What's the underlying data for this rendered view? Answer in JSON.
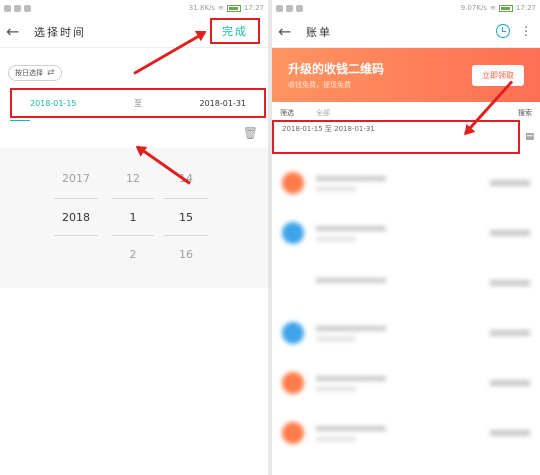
{
  "left": {
    "status_bar": {
      "text": "31.8K/s",
      "time": "17:27"
    },
    "title": "选择时间",
    "done_label": "完成",
    "chip_label": "按日选择",
    "range": {
      "start": "2018-01-15",
      "separator": "至",
      "end": "2018-01-31"
    },
    "picker": {
      "years": [
        "2017",
        "2018",
        ""
      ],
      "months": [
        "12",
        "1",
        "2"
      ],
      "days": [
        "14",
        "15",
        "16"
      ]
    }
  },
  "right": {
    "status_bar": {
      "text": "9.07K/s",
      "time": "17:27"
    },
    "title": "账单",
    "banner": {
      "title": "升级的收钱二维码",
      "subtitle": "收钱免费，提现免费",
      "button_label": "立即领取"
    },
    "filter": {
      "label": "筛选",
      "label2": "全部",
      "search_label": "搜索"
    },
    "range_text": "2018-01-15 至 2018-01-31",
    "list": [
      {
        "avatar": "orange"
      },
      {
        "avatar": "blue"
      },
      {
        "avatar": "none"
      },
      {
        "avatar": "blue"
      },
      {
        "avatar": "orange"
      },
      {
        "avatar": "orange"
      }
    ]
  },
  "colors": {
    "accent": "#19b7a6",
    "highlight": "#e02020",
    "banner": "#ff7b55"
  }
}
